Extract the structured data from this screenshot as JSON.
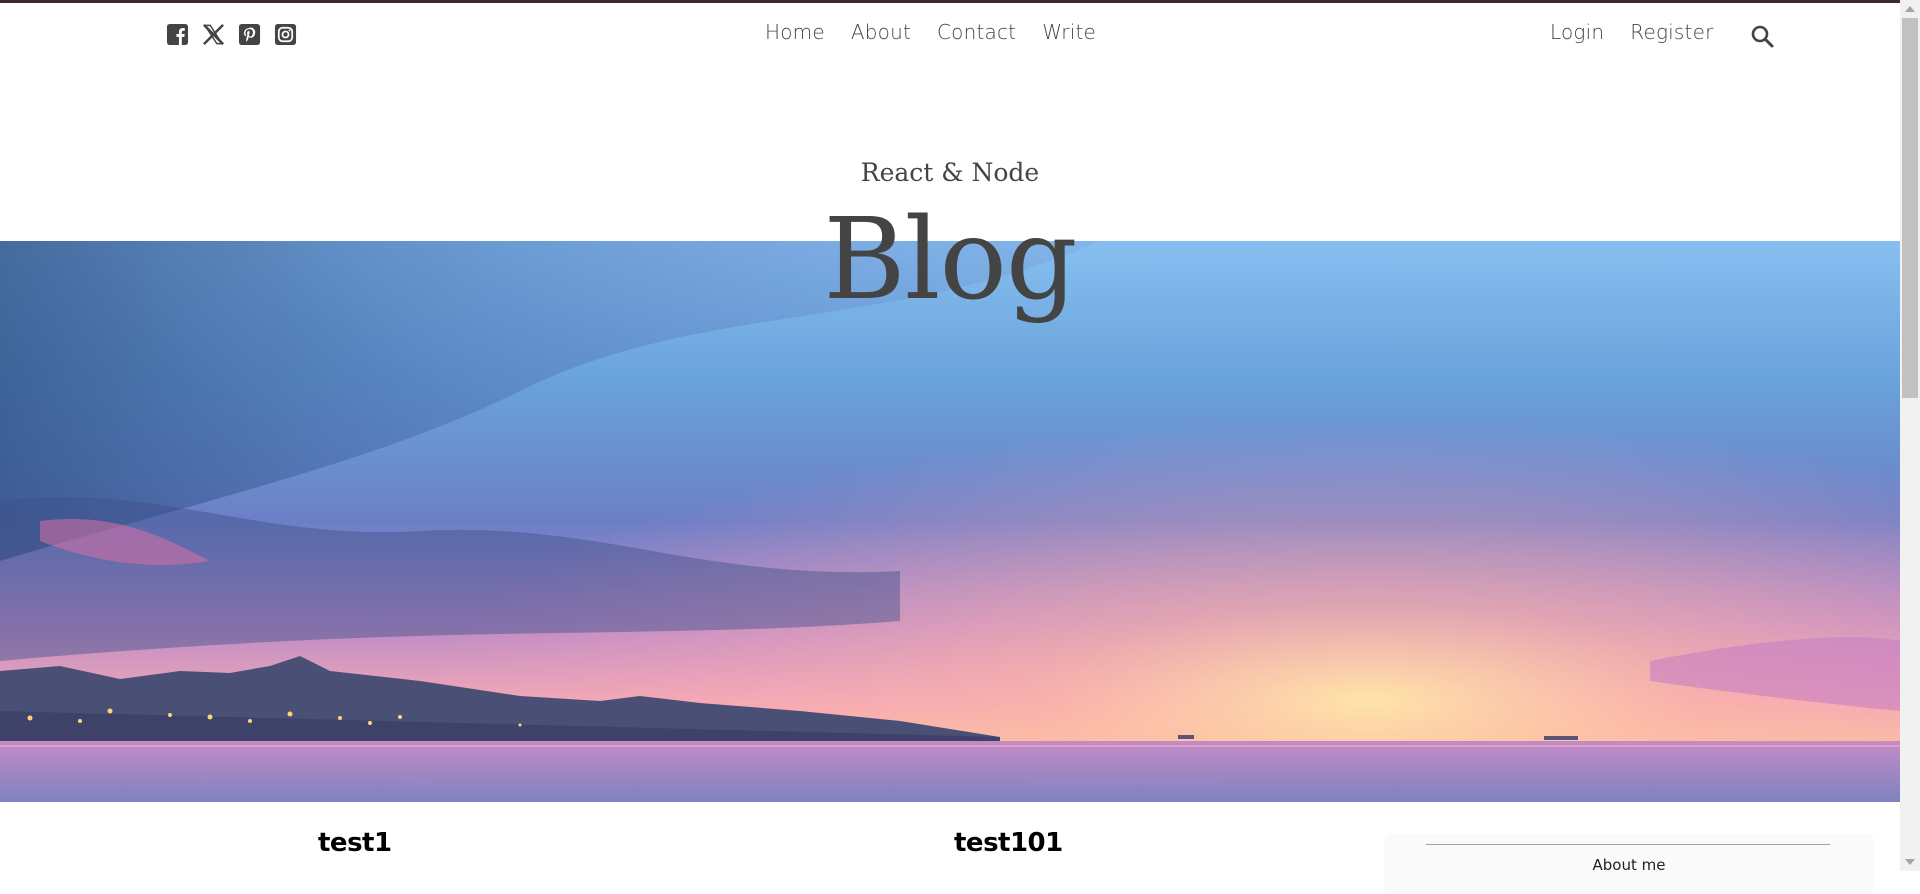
{
  "social": {
    "icons": [
      "facebook-square-icon",
      "x-twitter-icon",
      "pinterest-square-icon",
      "instagram-square-icon"
    ]
  },
  "nav": {
    "items": [
      {
        "label": "Home"
      },
      {
        "label": "About"
      },
      {
        "label": "Contact"
      },
      {
        "label": "Write"
      }
    ],
    "login": "Login",
    "register": "Register",
    "search_icon": "search-icon"
  },
  "header": {
    "subtitle": "React & Node",
    "title": "Blog",
    "image": "sunset-sea-coast-landscape"
  },
  "posts": [
    {
      "title": "test1"
    },
    {
      "title": "test101"
    }
  ],
  "sidebar": {
    "title": "About me"
  },
  "colors": {
    "text": "#444444",
    "top_border": "#3b2a2f"
  }
}
